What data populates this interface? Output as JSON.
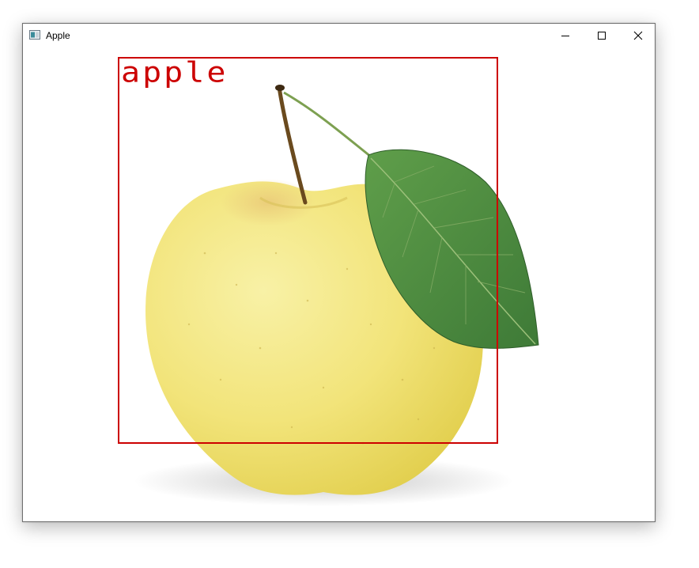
{
  "window": {
    "title": "Apple",
    "icon": "window-app-icon",
    "controls": {
      "minimize_icon": "minimize-icon",
      "maximize_icon": "maximize-icon",
      "close_icon": "close-icon"
    }
  },
  "detection": {
    "label": "apple",
    "box_color": "#cc0000"
  },
  "image": {
    "subject": "yellow-apple-with-leaf"
  }
}
